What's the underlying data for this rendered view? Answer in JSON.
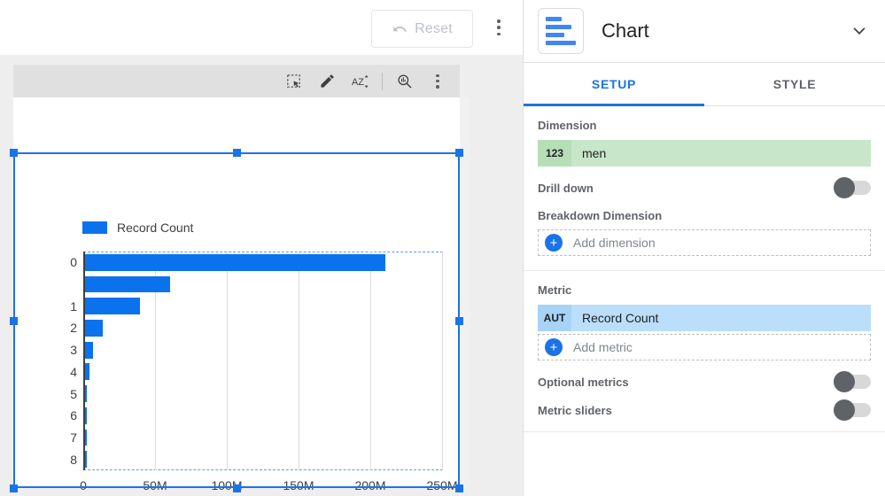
{
  "toolbar": {
    "reset_label": "Reset",
    "undo_icon": "undo-icon",
    "more_icon": "more-vert-icon"
  },
  "chart_toolbar": {
    "icons": [
      {
        "name": "select-icon",
        "label": "Select"
      },
      {
        "name": "edit-pencil-icon",
        "label": "Edit"
      },
      {
        "name": "sort-az-icon",
        "label": "Sort A-Z"
      },
      {
        "name": "explore-icon",
        "label": "Explore"
      },
      {
        "name": "more-vert-icon",
        "label": "More options"
      }
    ]
  },
  "chart_data": {
    "type": "bar",
    "orientation": "horizontal",
    "title": "",
    "xlabel": "",
    "ylabel": "",
    "legend": [
      {
        "name": "Record Count",
        "color": "#0b72ed"
      }
    ],
    "legend_position": "top-left",
    "grid": true,
    "xlim": [
      0,
      250000000
    ],
    "xticks": [
      0,
      50000000,
      100000000,
      150000000,
      200000000,
      250000000
    ],
    "xticklabels": [
      "0",
      "50M",
      "100M",
      "150M",
      "200M",
      "250M"
    ],
    "categories": [
      "0",
      "",
      "1",
      "2",
      "3",
      "4",
      "5",
      "6",
      "7",
      "8"
    ],
    "yticklabels": [
      "0",
      "1",
      "2",
      "3",
      "4",
      "5",
      "6",
      "7",
      "8"
    ],
    "series": [
      {
        "name": "Record Count",
        "color": "#0b72ed",
        "values": [
          210000000,
          60000000,
          39000000,
          13000000,
          6000000,
          3500000,
          1800000,
          1300000,
          1200000,
          1000000
        ]
      }
    ]
  },
  "panel": {
    "title": "Chart",
    "type_icon": "bar-chart-icon",
    "collapse_icon": "chevron-down-icon",
    "tabs": [
      {
        "label": "SETUP",
        "active": true
      },
      {
        "label": "STYLE",
        "active": false
      }
    ],
    "dimension": {
      "section_label": "Dimension",
      "chip": {
        "badge": "123",
        "name": "men"
      },
      "drill_down_label": "Drill down",
      "drill_down_on": false,
      "breakdown_label": "Breakdown Dimension",
      "add_dimension_placeholder": "Add dimension"
    },
    "metric": {
      "section_label": "Metric",
      "chip": {
        "badge": "AUT",
        "name": "Record Count"
      },
      "add_metric_placeholder": "Add metric",
      "optional_metrics_label": "Optional metrics",
      "optional_metrics_on": false,
      "metric_sliders_label": "Metric sliders",
      "metric_sliders_on": false
    }
  },
  "colors": {
    "accent": "#1a73e8",
    "bar": "#0b72ed",
    "dimension_chip": "#c8e6c9",
    "metric_chip": "#bbdefb"
  }
}
